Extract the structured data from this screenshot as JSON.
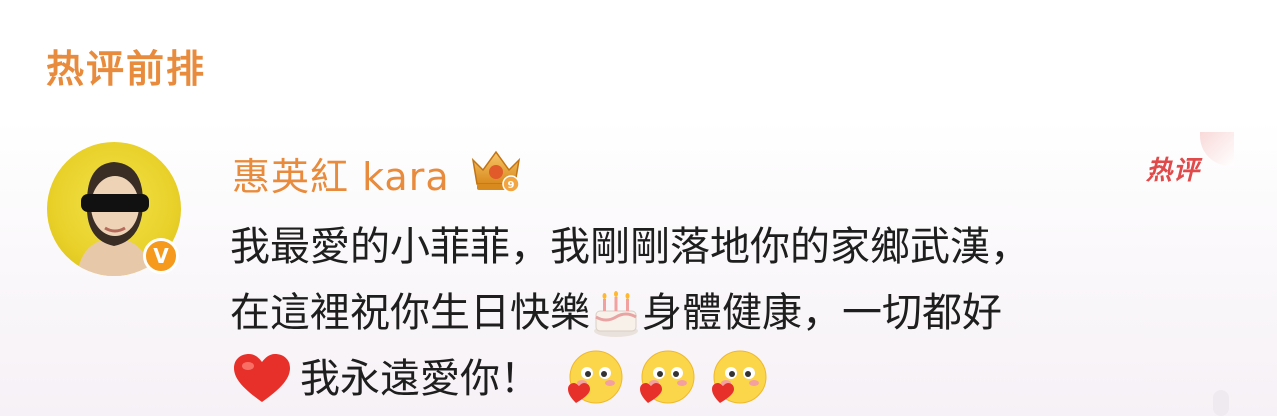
{
  "section": {
    "title": "热评前排"
  },
  "comment": {
    "username": "惠英紅 kara",
    "hot_label": "热评",
    "verified_badge": "V",
    "line1": "我最愛的小菲菲，我剛剛落地你的家鄉武漢，",
    "line2_a": "在這裡祝你生日快樂",
    "line2_b": " 身體健康，一切都好",
    "line3": "我永遠愛你！"
  },
  "icons": {
    "crown": "vip-crown-icon",
    "cake": "birthday-cake-icon",
    "heart": "red-heart-icon",
    "love_face": "love-face-emoji-icon"
  },
  "colors": {
    "accent_orange": "#e88b3c",
    "hot_red": "#e04a4a",
    "text": "#1e1e1e"
  }
}
